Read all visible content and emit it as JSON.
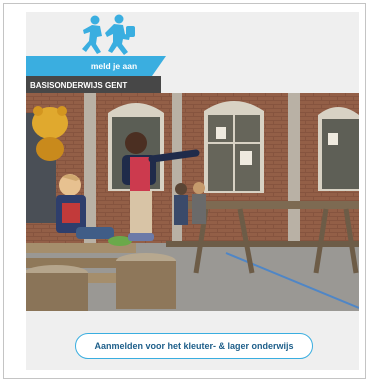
{
  "brand": {
    "logo_icon": "running-children-icon",
    "tagline": "meld je aan",
    "subtitle": "BASISONDERWIJS GENT",
    "accent": "#3aaee0",
    "dark": "#474747"
  },
  "photo": {
    "icon": "schoolyard-photo"
  },
  "cta": {
    "label": "Aanmelden voor het kleuter- & lager onderwijs"
  }
}
